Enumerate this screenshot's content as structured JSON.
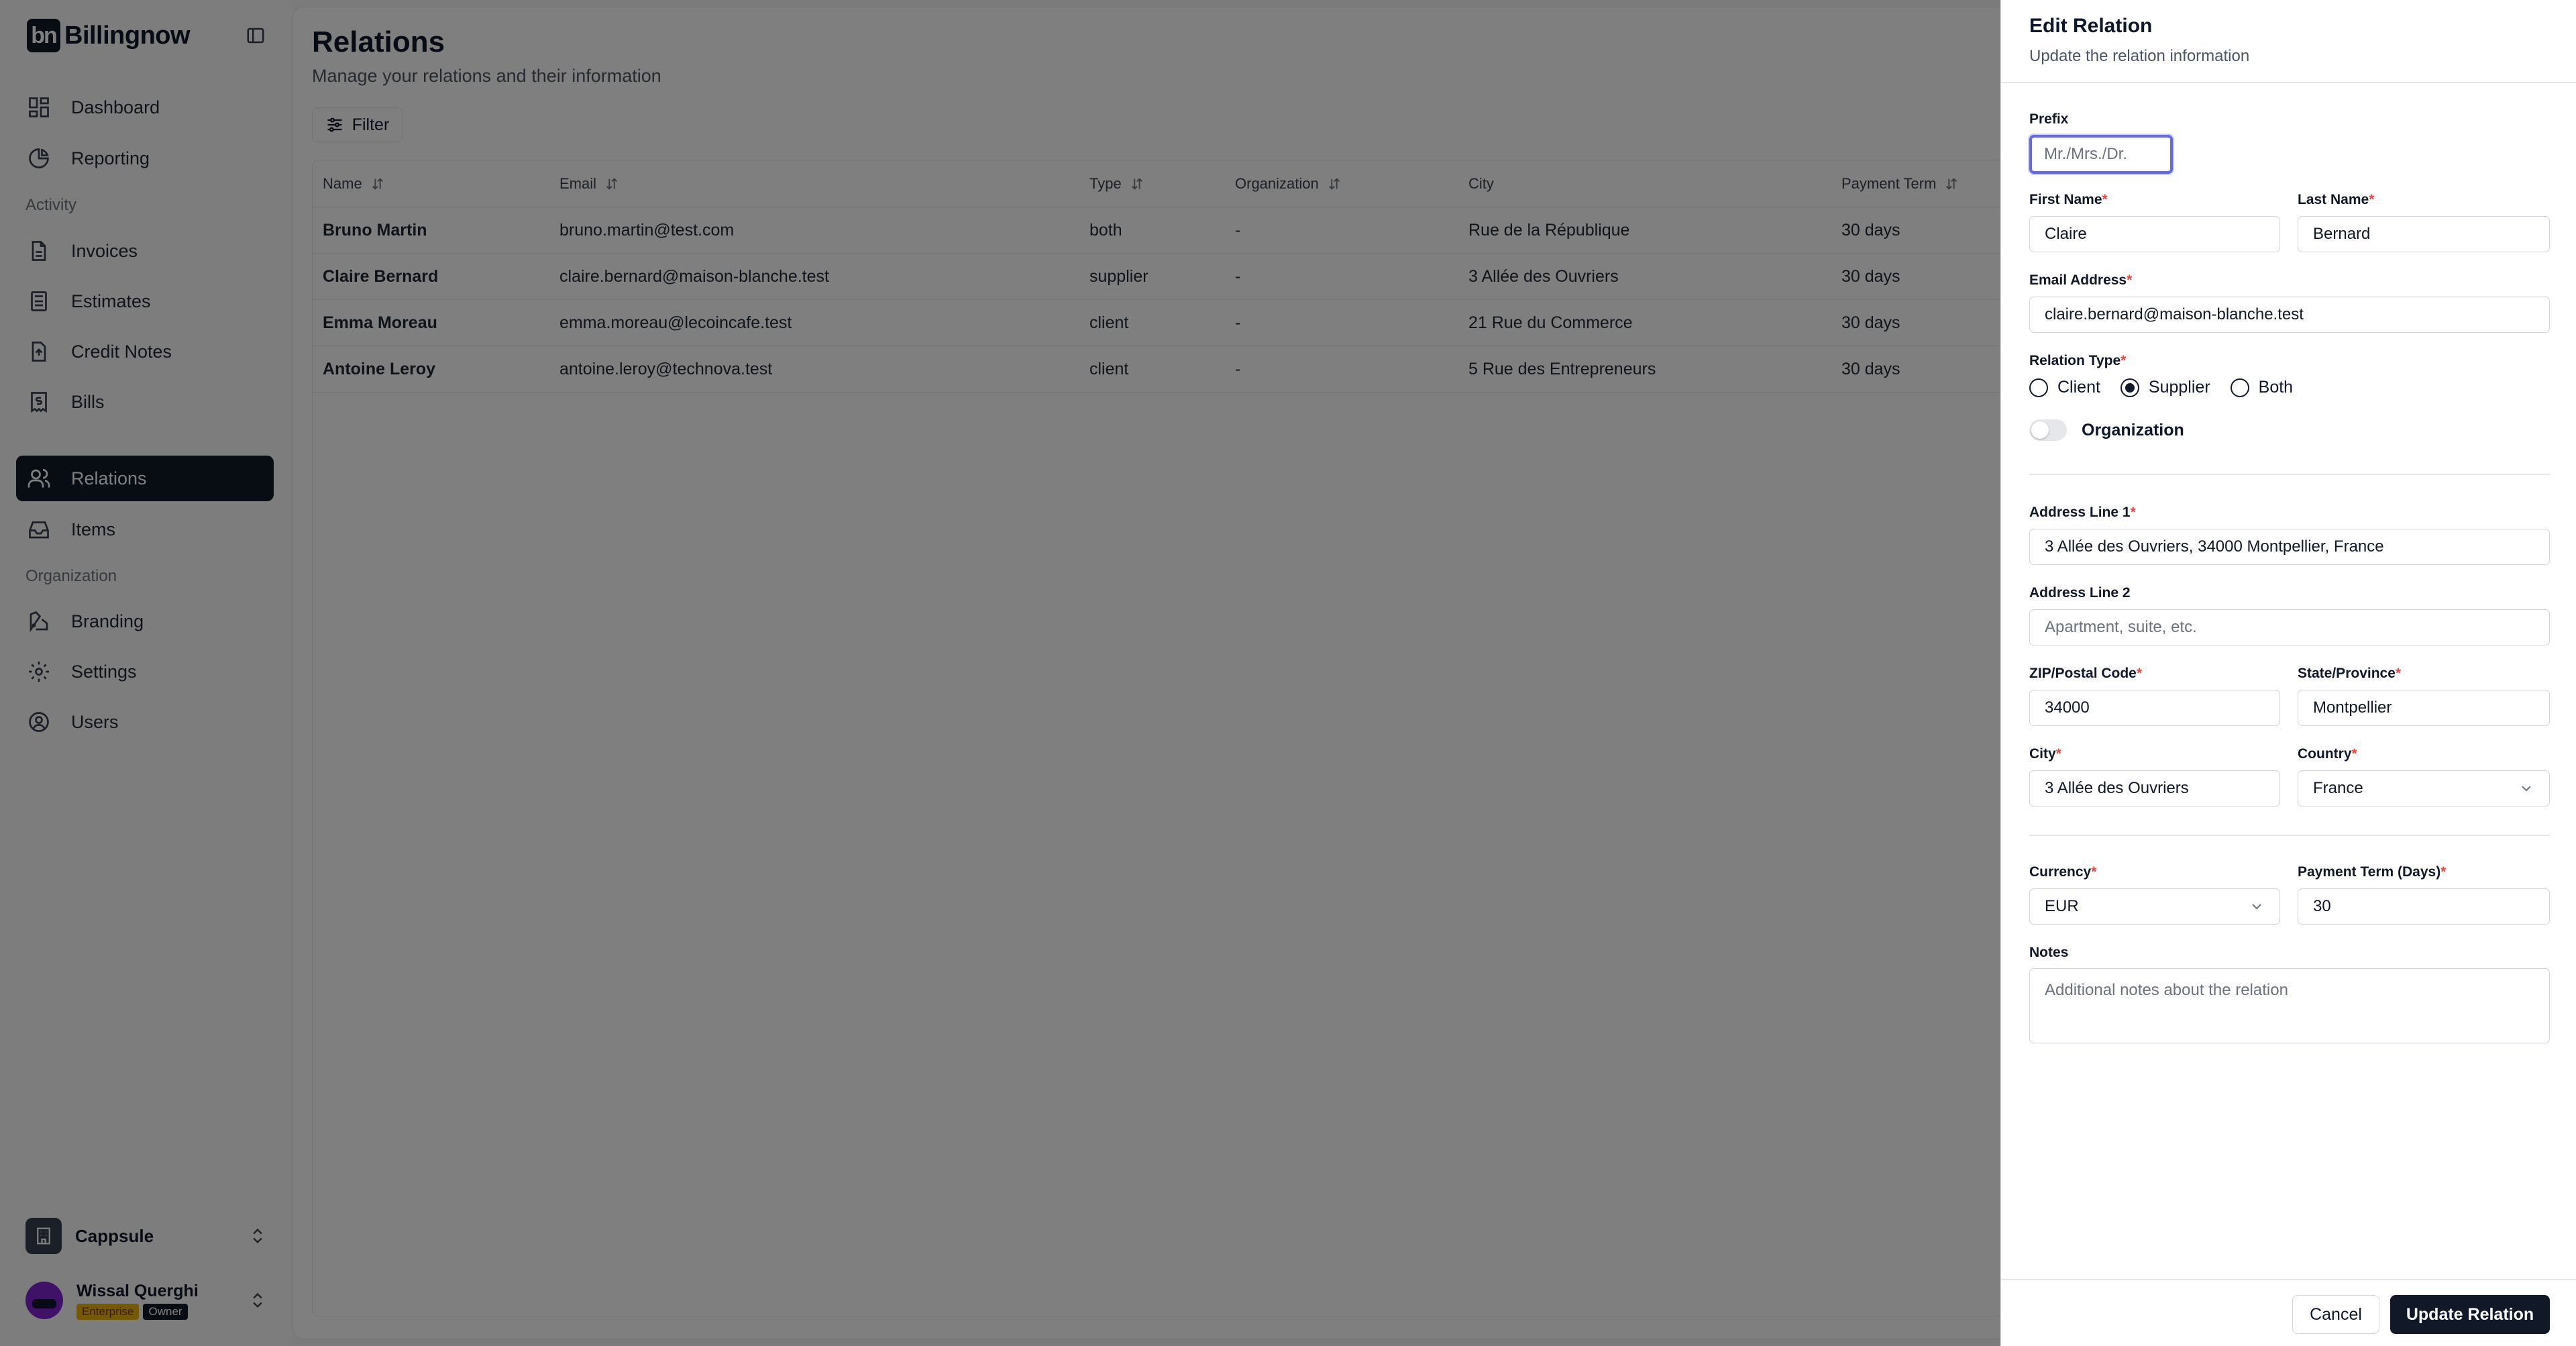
{
  "app": {
    "logo_mark": "bn",
    "name": "Billingnow"
  },
  "sidebar": {
    "items": [
      {
        "label": "Dashboard",
        "icon": "dashboard-icon"
      },
      {
        "label": "Reporting",
        "icon": "pie-chart-icon"
      },
      {
        "label": "Invoices",
        "icon": "file-text-icon"
      },
      {
        "label": "Estimates",
        "icon": "calculator-icon"
      },
      {
        "label": "Credit Notes",
        "icon": "receipt-icon"
      },
      {
        "label": "Bills",
        "icon": "bill-icon"
      },
      {
        "label": "Relations",
        "icon": "users-icon",
        "active": true
      },
      {
        "label": "Items",
        "icon": "inbox-icon"
      },
      {
        "label": "Branding",
        "icon": "palette-icon"
      },
      {
        "label": "Settings",
        "icon": "gear-icon"
      },
      {
        "label": "Users",
        "icon": "user-circle-icon"
      }
    ],
    "sections": {
      "activity": "Activity",
      "organization": "Organization"
    },
    "org_name": "Cappsule",
    "user": {
      "name": "Wissal Querghi",
      "badge_plan": "Enterprise",
      "badge_role": "Owner"
    }
  },
  "page": {
    "title": "Relations",
    "subtitle": "Manage your relations and their information",
    "filter_label": "Filter"
  },
  "table": {
    "columns": [
      "Name",
      "Email",
      "Type",
      "Organization",
      "City",
      "Payment Term"
    ],
    "rows": [
      {
        "name": "Bruno Martin",
        "email": "bruno.martin@test.com",
        "type": "both",
        "org": "-",
        "city": "Rue de la République",
        "term": "30 days"
      },
      {
        "name": "Claire Bernard",
        "email": "claire.bernard@maison-blanche.test",
        "type": "supplier",
        "org": "-",
        "city": "3 Allée des Ouvriers",
        "term": "30 days"
      },
      {
        "name": "Emma Moreau",
        "email": "emma.moreau@lecoincafe.test",
        "type": "client",
        "org": "-",
        "city": "21 Rue du Commerce",
        "term": "30 days"
      },
      {
        "name": "Antoine Leroy",
        "email": "antoine.leroy@technova.test",
        "type": "client",
        "org": "-",
        "city": "5 Rue des Entrepreneurs",
        "term": "30 days"
      }
    ]
  },
  "panel": {
    "title": "Edit Relation",
    "subtitle": "Update the relation information",
    "prefix": {
      "label": "Prefix",
      "placeholder": "Mr./Mrs./Dr."
    },
    "first_name": {
      "label": "First Name",
      "value": "Claire"
    },
    "last_name": {
      "label": "Last Name",
      "value": "Bernard"
    },
    "email": {
      "label": "Email Address",
      "value": "claire.bernard@maison-blanche.test"
    },
    "relation_type": {
      "label": "Relation Type",
      "options": [
        "Client",
        "Supplier",
        "Both"
      ],
      "selected": "Supplier"
    },
    "organization_toggle": {
      "label": "Organization",
      "on": false
    },
    "address1": {
      "label": "Address Line 1",
      "value": "3 Allée des Ouvriers, 34000 Montpellier, France"
    },
    "address2": {
      "label": "Address Line 2",
      "placeholder": "Apartment, suite, etc."
    },
    "zip": {
      "label": "ZIP/Postal Code",
      "value": "34000"
    },
    "state": {
      "label": "State/Province",
      "value": "Montpellier"
    },
    "city": {
      "label": "City",
      "value": "3 Allée des Ouvriers"
    },
    "country": {
      "label": "Country",
      "value": "France"
    },
    "currency": {
      "label": "Currency",
      "value": "EUR"
    },
    "payment_term": {
      "label": "Payment Term (Days)",
      "value": "30"
    },
    "notes": {
      "label": "Notes",
      "placeholder": "Additional notes about the relation"
    },
    "cancel_label": "Cancel",
    "submit_label": "Update Relation",
    "required_mark": "*"
  },
  "colors": {
    "primary": "#111827",
    "focus": "#6366f1",
    "required": "#ef4444",
    "overlay": "rgba(0,0,0,0.5)"
  }
}
